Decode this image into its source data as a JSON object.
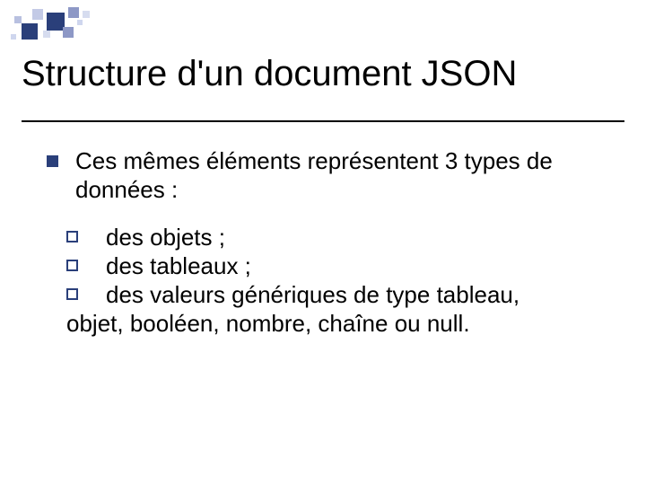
{
  "title": "Structure d'un document JSON",
  "level1": {
    "text": "Ces mêmes éléments représentent 3 types de données :"
  },
  "level2": {
    "items": [
      "des objets ;",
      "des tableaux ;",
      "des valeurs génériques de type tableau,"
    ],
    "continuation": "objet, booléen, nombre, chaîne ou null."
  }
}
